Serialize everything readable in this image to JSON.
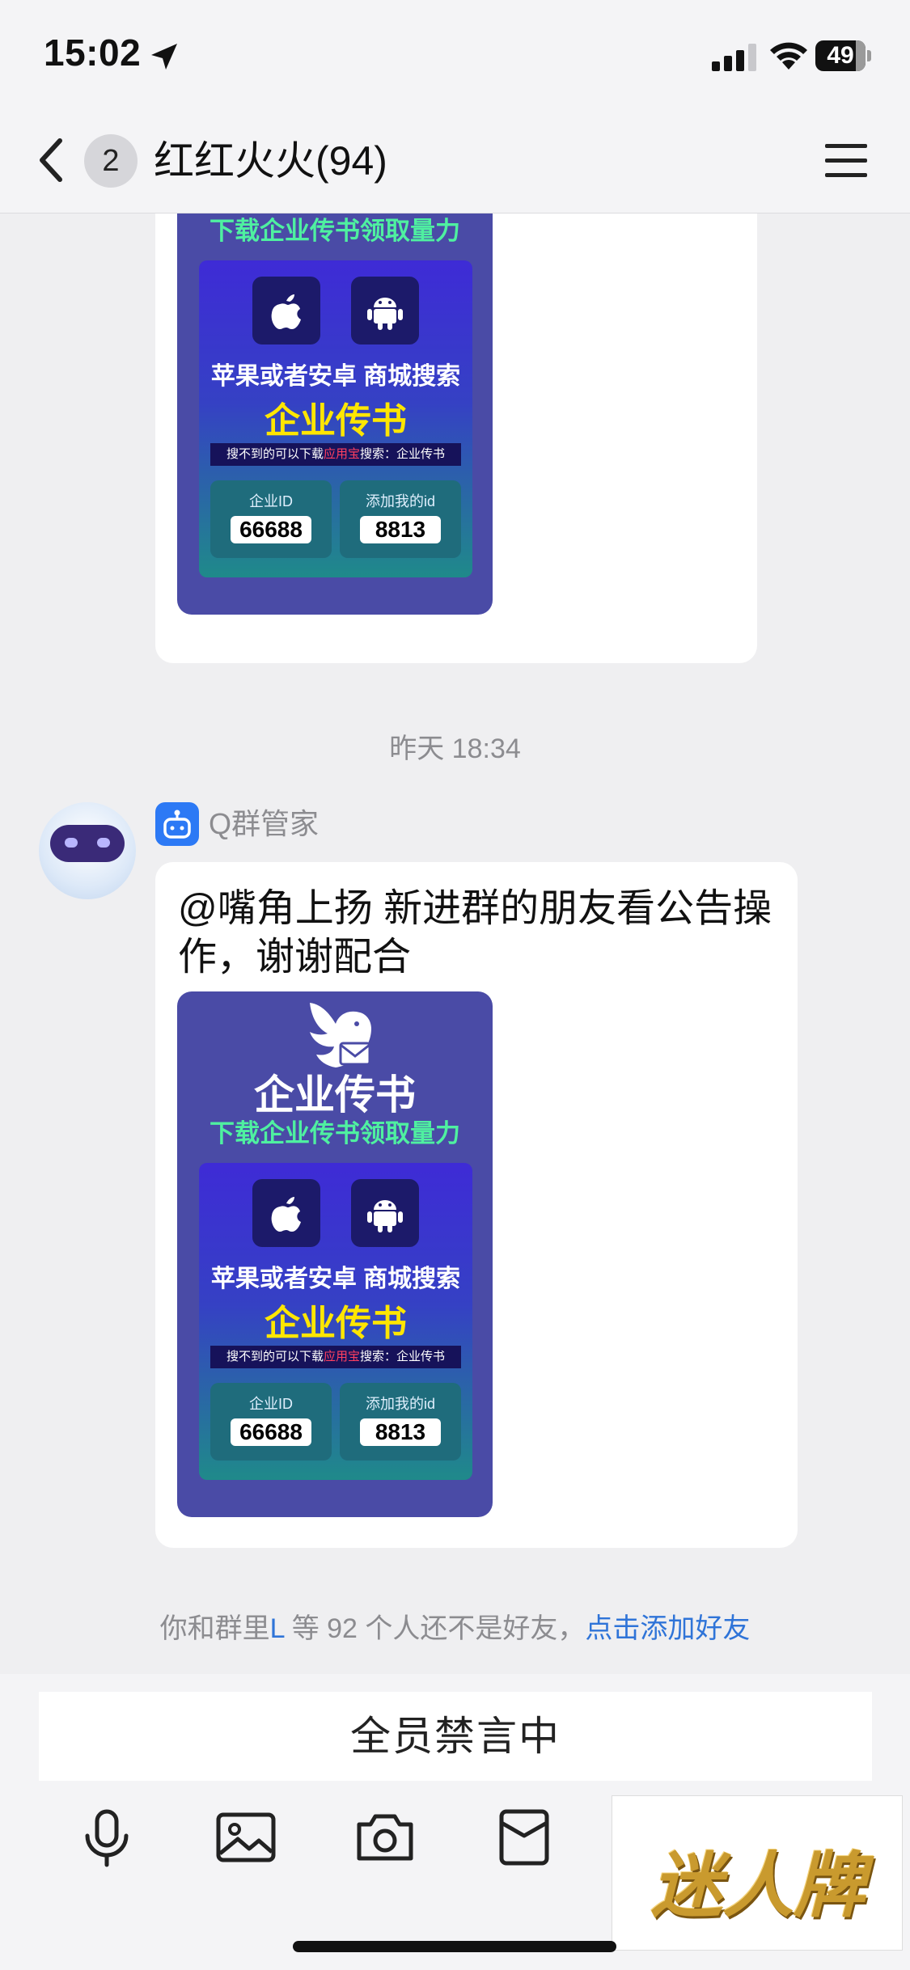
{
  "status_bar": {
    "time": "15:02",
    "battery": "49"
  },
  "nav": {
    "unread_count": "2",
    "title": "红红火火(94)"
  },
  "poster": {
    "title": "企业传书",
    "subtitle": "下载企业传书领取量力",
    "line1": "苹果或者安卓 商城搜索",
    "line2": "企业传书",
    "note_pre": "搜不到的可以下载",
    "note_hl": "应用宝",
    "note_post": "搜索：企业传书",
    "id_label": "企业ID",
    "id_value": "66688",
    "add_label": "添加我的id",
    "add_value": "8813"
  },
  "timestamp": "昨天 18:34",
  "message": {
    "sender": "Q群管家",
    "text": "@嘴角上扬 新进群的朋友看公告操作，谢谢配合"
  },
  "friend_notice": {
    "pre": "你和群里",
    "name": "L",
    "mid": "等 92 个人还不是好友，",
    "link": "点击添加好友"
  },
  "input": {
    "muted_label": "全员禁言中"
  },
  "watermark": "迷人牌",
  "colors": {
    "accent": "#2f74d8",
    "poster_bg": "#4a4ba6",
    "highlight": "#ffe600"
  }
}
